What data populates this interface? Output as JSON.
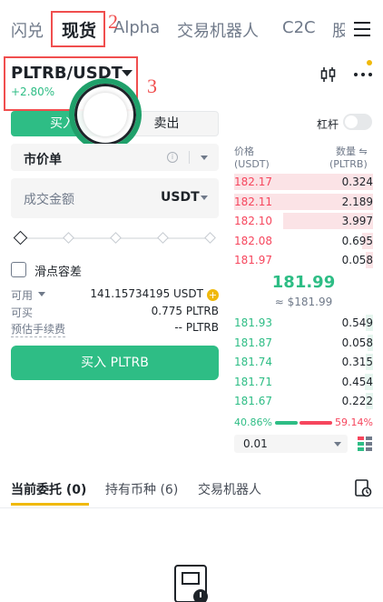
{
  "top_tabs": {
    "items": [
      "闪兑",
      "现货",
      "Alpha",
      "交易机器人",
      "C2C",
      "股"
    ],
    "active_index": 1
  },
  "annotations": {
    "tab_marker": "2",
    "pair_marker": "3"
  },
  "pair": {
    "symbol": "PLTRB/USDT",
    "change": "+2.80%"
  },
  "trade": {
    "buy_tab": "买入",
    "sell_tab": "卖出",
    "order_type": "市价单",
    "amount_placeholder": "成交金额",
    "amount_unit": "USDT",
    "slippage_label": "滑点容差",
    "available_label": "可用",
    "available_value": "141.15734195 USDT",
    "can_buy_label": "可买",
    "can_buy_value": "0.775 PLTRB",
    "fee_label": "预估手续费",
    "fee_value": "-- PLTRB",
    "buy_button": "买入 PLTRB"
  },
  "orderbook": {
    "leverage_label": "杠杆",
    "price_header": "价格",
    "price_unit": "(USDT)",
    "qty_header": "数量",
    "qty_unit": "(PLTRB)",
    "asks": [
      {
        "price": "182.17",
        "qty": "0.324",
        "depth": 1.0
      },
      {
        "price": "182.11",
        "qty": "2.189",
        "depth": 1.0
      },
      {
        "price": "182.10",
        "qty": "3.997",
        "depth": 0.65
      },
      {
        "price": "182.08",
        "qty": "0.695",
        "depth": 0.08
      },
      {
        "price": "181.97",
        "qty": "0.058",
        "depth": 0.05
      }
    ],
    "mid_price": "181.99",
    "mid_usd": "≈ $181.99",
    "bids": [
      {
        "price": "181.93",
        "qty": "0.549",
        "depth": 0.05
      },
      {
        "price": "181.87",
        "qty": "0.058",
        "depth": 0.04
      },
      {
        "price": "181.74",
        "qty": "0.315",
        "depth": 0.05
      },
      {
        "price": "181.71",
        "qty": "0.454",
        "depth": 0.06
      },
      {
        "price": "181.67",
        "qty": "0.222",
        "depth": 0.05
      }
    ],
    "buy_ratio": "40.86%",
    "sell_ratio": "59.14%",
    "precision": "0.01"
  },
  "bottom_tabs": {
    "items": [
      "当前委托 (0)",
      "持有币种 (6)",
      "交易机器人"
    ],
    "active_index": 0
  },
  "colors": {
    "green": "#2ebd85",
    "red": "#f6465d",
    "yellow": "#f0b90b",
    "annotation_red": "#f04e4e"
  }
}
